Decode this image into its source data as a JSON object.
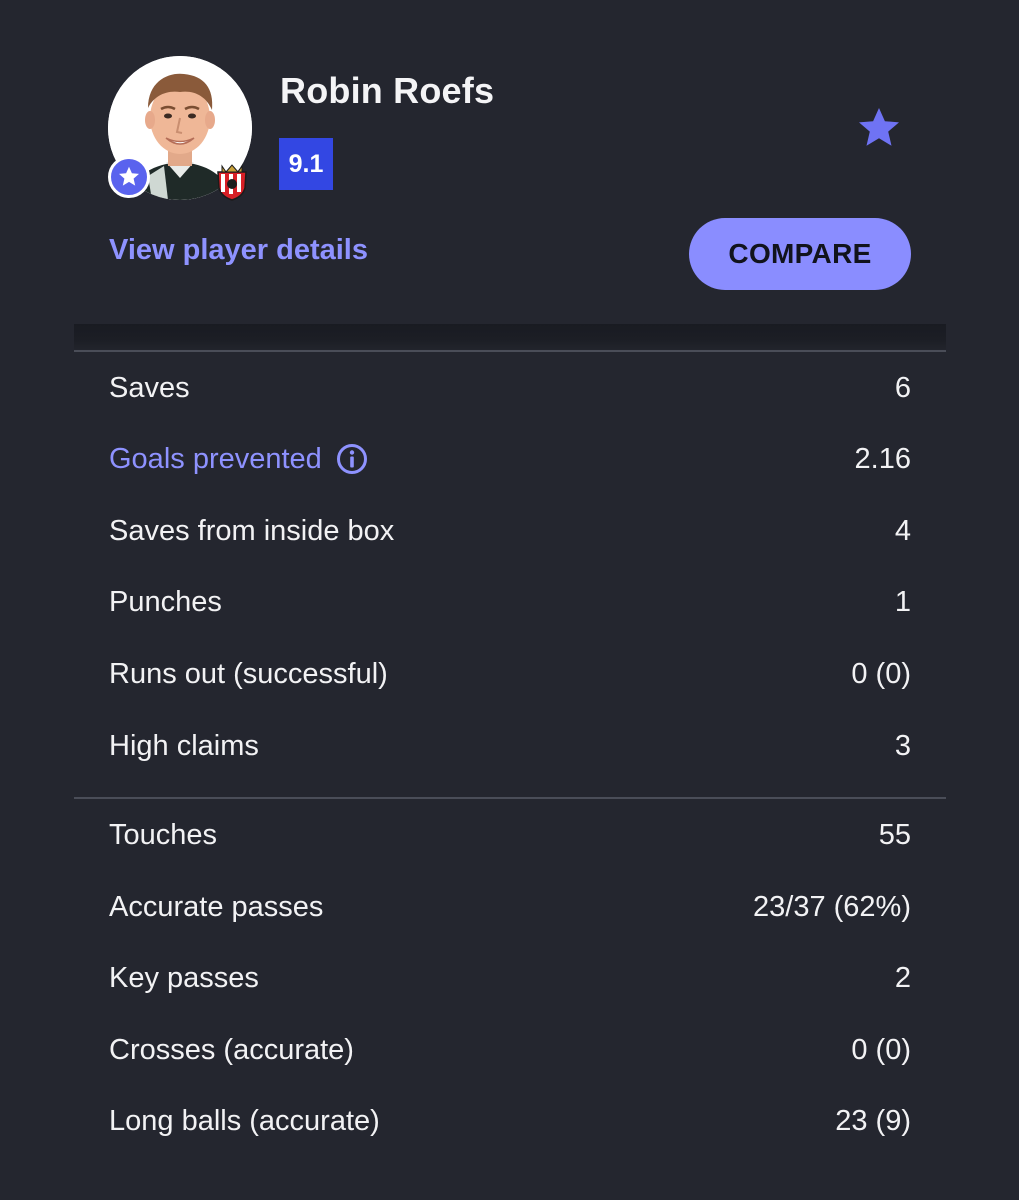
{
  "player": {
    "name": "Robin Roefs",
    "rating": "9.1",
    "details_link": "View player details",
    "compare_label": "COMPARE"
  },
  "colors": {
    "background": "#24262f",
    "accent": "#8e92ff",
    "rating_bg": "#3347e3",
    "badge": "#5a63ee"
  },
  "icons": {
    "favorite": "star-icon",
    "potm": "star-badge-icon",
    "info": "info-icon",
    "club": "club-crest-icon"
  },
  "stats_group_1": [
    {
      "label": "Saves",
      "value": "6"
    },
    {
      "label": "Goals prevented",
      "value": "2.16"
    },
    {
      "label": "Saves from inside box",
      "value": "4"
    },
    {
      "label": "Punches",
      "value": "1"
    },
    {
      "label": "Runs out (successful)",
      "value": "0 (0)"
    },
    {
      "label": "High claims",
      "value": "3"
    }
  ],
  "stats_group_2": [
    {
      "label": "Touches",
      "value": "55"
    },
    {
      "label": "Accurate passes",
      "value": "23/37 (62%)"
    },
    {
      "label": "Key passes",
      "value": "2"
    },
    {
      "label": "Crosses (accurate)",
      "value": "0 (0)"
    },
    {
      "label": "Long balls (accurate)",
      "value": "23 (9)"
    }
  ]
}
